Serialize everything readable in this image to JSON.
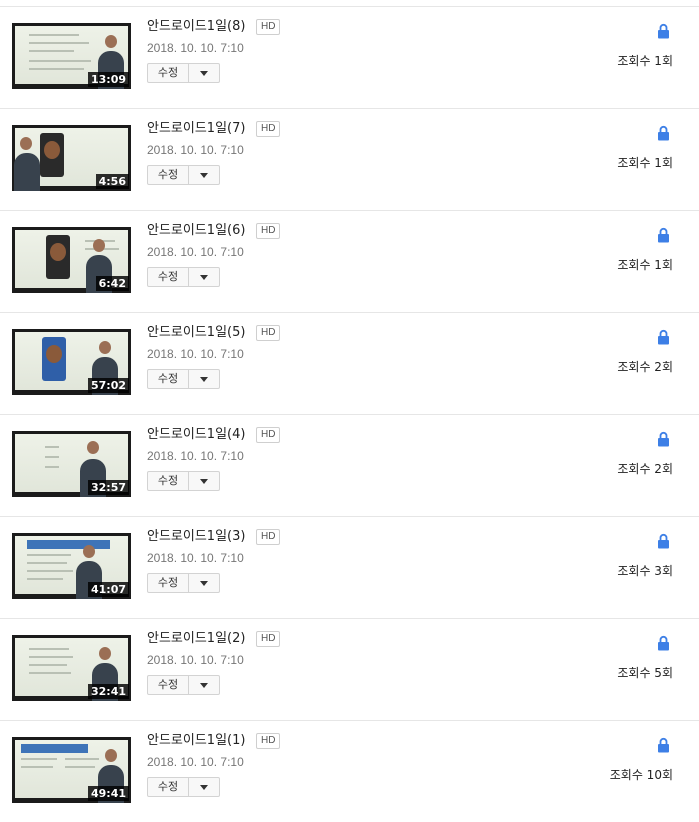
{
  "videos": [
    {
      "title": "안드로이드1일(8)",
      "badge": "HD",
      "date": "2018. 10. 10. 7:10",
      "edit_label": "수정",
      "duration": "13:09",
      "views": "조회수 1회",
      "thumb": "slides"
    },
    {
      "title": "안드로이드1일(7)",
      "badge": "HD",
      "date": "2018. 10. 10. 7:10",
      "edit_label": "수정",
      "duration": "4:56",
      "views": "조회수 1회",
      "thumb": "phone"
    },
    {
      "title": "안드로이드1일(6)",
      "badge": "HD",
      "date": "2018. 10. 10. 7:10",
      "edit_label": "수정",
      "duration": "6:42",
      "views": "조회수 1회",
      "thumb": "phone"
    },
    {
      "title": "안드로이드1일(5)",
      "badge": "HD",
      "date": "2018. 10. 10. 7:10",
      "edit_label": "수정",
      "duration": "57:02",
      "views": "조회수 2회",
      "thumb": "phone"
    },
    {
      "title": "안드로이드1일(4)",
      "badge": "HD",
      "date": "2018. 10. 10. 7:10",
      "edit_label": "수정",
      "duration": "32:57",
      "views": "조회수 2회",
      "thumb": "slides"
    },
    {
      "title": "안드로이드1일(3)",
      "badge": "HD",
      "date": "2018. 10. 10. 7:10",
      "edit_label": "수정",
      "duration": "41:07",
      "views": "조회수 3회",
      "thumb": "header"
    },
    {
      "title": "안드로이드1일(2)",
      "badge": "HD",
      "date": "2018. 10. 10. 7:10",
      "edit_label": "수정",
      "duration": "32:41",
      "views": "조회수 5회",
      "thumb": "slides"
    },
    {
      "title": "안드로이드1일(1)",
      "badge": "HD",
      "date": "2018. 10. 10. 7:10",
      "edit_label": "수정",
      "duration": "49:41",
      "views": "조회수 10회",
      "thumb": "header"
    }
  ],
  "colors": {
    "lock": "#3d7fe6",
    "thumb_bg": "#1b1b1b"
  },
  "icons": {
    "lock": "lock-icon",
    "dropdown": "chevron-down-icon"
  }
}
